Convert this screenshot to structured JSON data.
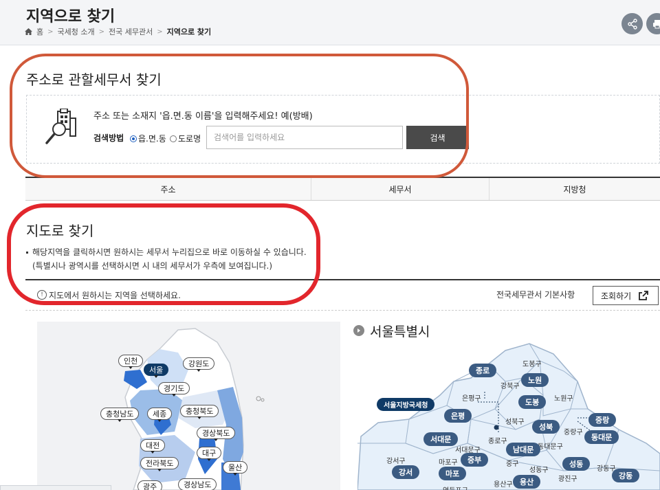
{
  "header": {
    "title": "지역으로 찾기",
    "breadcrumb": [
      "홈",
      "국세청 소개",
      "전국 세무관서",
      "지역으로 찾기"
    ]
  },
  "address_search": {
    "title": "주소로 관할세무서 찾기",
    "guide": "주소 또는 소재지 '읍.면.동 이름'을 입력해주세요! 예(방배)",
    "method_label": "검색방법",
    "options": [
      "읍.면.동",
      "도로명"
    ],
    "selected_option": "읍.면.동",
    "placeholder": "검색어를 입력하세요",
    "search_button": "검색",
    "result_columns": [
      "주소",
      "세무서",
      "지방청"
    ]
  },
  "map_search": {
    "title": "지도로 찾기",
    "desc_line1": "해당지역을 클릭하시면 원하시는 세무서 누리집으로 바로 이동하실 수 있습니다.",
    "desc_line2": "(특별시나 광역시를 선택하시면 시 내의 세무서가 우측에 보여집니다.)",
    "hint": "지도에서 원하시는 지역을 선택하세요.",
    "info_label": "전국세무관서 기본사항",
    "view_button": "조회하기",
    "regions": [
      "인천",
      "서울",
      "강원도",
      "경기도",
      "충청남도",
      "세종",
      "충청북도",
      "경상북도",
      "대전",
      "대구",
      "전라북도",
      "울산",
      "광주",
      "경상남도"
    ],
    "active_region": "서울"
  },
  "seoul": {
    "title": "서울특별시",
    "regional_office": "서울지방국세청",
    "offices": [
      "종로",
      "노원",
      "도봉",
      "은평",
      "성북",
      "중랑",
      "서대문",
      "동대문",
      "남대문",
      "중부",
      "성동",
      "강서",
      "마포",
      "용산",
      "강동"
    ],
    "districts": [
      "도봉구",
      "강북구",
      "노원구",
      "은평구",
      "성북구",
      "중랑구",
      "종로구",
      "동대문구",
      "서대문구",
      "중구",
      "강서구",
      "마포구",
      "성동구",
      "광진구",
      "강동구",
      "용산구",
      "영등포구"
    ]
  },
  "colors": {
    "accent": "#0f3a66",
    "office": "#3b5b82",
    "highlight_orange": "#d0593a",
    "highlight_red": "#e2262c"
  }
}
